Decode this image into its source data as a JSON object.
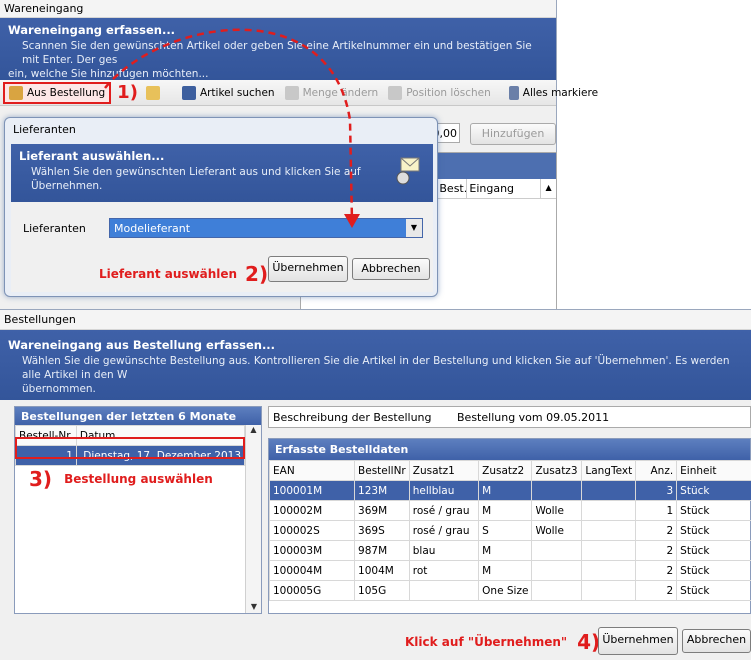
{
  "win1": {
    "title": "Wareneingang",
    "banner_title": "Wareneingang erfassen...",
    "banner_line1": "Scannen Sie den gewünschten Artikel oder geben Sie eine Artikelnummer ein und bestätigen Sie mit Enter. Der ges",
    "banner_line2": "ein, welche Sie hinzufügen möchten...",
    "toolbar": {
      "aus_bestellung": "Aus Bestellung",
      "artikel_suchen": "Artikel suchen",
      "menge_aendern": "Menge ändern",
      "position_loeschen": "Position löschen",
      "alles_markieren": "Alles markiere"
    },
    "qty_value": "0,00",
    "hinzufuegen": "Hinzufügen",
    "grid_cols": [
      "Best.",
      "Eingang"
    ]
  },
  "dialog": {
    "title": "Lieferanten",
    "banner_title": "Lieferant auswählen...",
    "banner_text1": "Wählen Sie den gewünschten Lieferant aus und klicken Sie auf",
    "banner_text2": "Übernehmen.",
    "field_label": "Lieferanten",
    "field_value": "Modelieferant",
    "ok": "Übernehmen",
    "cancel": "Abbrechen"
  },
  "annotations": {
    "step1": "1)",
    "step2": "2)",
    "step2_text": "Lieferant auswählen",
    "step3": "3)",
    "step3_text": "Bestellung auswählen",
    "step4": "4)",
    "step4_text": "Klick auf \"Übernehmen\"",
    "color": "#e01d1d"
  },
  "win2": {
    "title": "Bestellungen",
    "banner_title": "Wareneingang aus Bestellung erfassen...",
    "banner_line1": "Wählen Sie die gewünschte Bestellung aus. Kontrollieren Sie die Artikel in der Bestellung und klicken Sie auf 'Übernehmen'. Es werden alle Artikel in den W",
    "banner_line2": "übernommen.",
    "left_panel_title": "Bestellungen der letzten 6 Monate",
    "left_cols": [
      "Bestell-Nr.",
      "Datum"
    ],
    "orders": [
      {
        "nr": "1",
        "datum": "Dienstag, 17. Dezember 2013"
      }
    ],
    "desc_label": "Beschreibung der Bestellung",
    "desc_value": "Bestellung vom 09.05.2011",
    "right_panel_title": "Erfasste Bestelldaten",
    "cols": [
      "EAN",
      "BestellNr",
      "Zusatz1",
      "Zusatz2",
      "Zusatz3",
      "LangText",
      "Anz.",
      "Einheit"
    ],
    "rows": [
      [
        "100001M",
        "123M",
        "hellblau",
        "M",
        "",
        "",
        "3",
        "Stück"
      ],
      [
        "100002M",
        "369M",
        "rosé / grau",
        "M",
        "Wolle",
        "",
        "1",
        "Stück"
      ],
      [
        "100002S",
        "369S",
        "rosé / grau",
        "S",
        "Wolle",
        "",
        "2",
        "Stück"
      ],
      [
        "100003M",
        "987M",
        "blau",
        "M",
        "",
        "",
        "2",
        "Stück"
      ],
      [
        "100004M",
        "1004M",
        "rot",
        "M",
        "",
        "",
        "2",
        "Stück"
      ],
      [
        "100005G",
        "105G",
        "",
        "One Size",
        "",
        "",
        "2",
        "Stück"
      ]
    ],
    "ok": "Übernehmen",
    "cancel": "Abbrechen"
  }
}
